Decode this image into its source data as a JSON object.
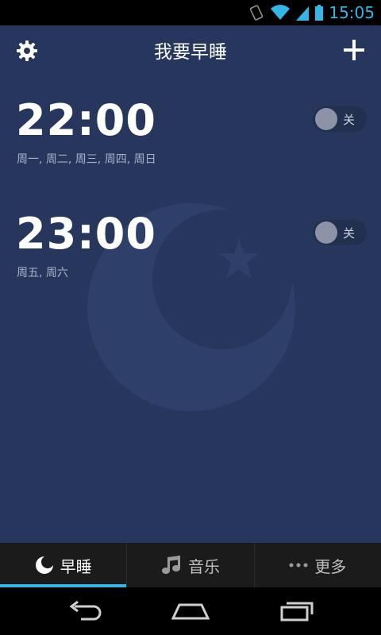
{
  "status_bar": {
    "time": "15:05",
    "icons": [
      "vibrate-icon",
      "wifi-icon",
      "signal-icon",
      "battery-icon"
    ],
    "accent": "#33b5e5"
  },
  "header": {
    "title": "我要早睡",
    "left_icon": "gear-icon",
    "right_icon": "plus-icon"
  },
  "alarms": [
    {
      "time": "22:00",
      "days": "周一, 周二, 周三, 周四, 周日",
      "toggle_label": "关",
      "enabled": false
    },
    {
      "time": "23:00",
      "days": "周五, 周六",
      "toggle_label": "关",
      "enabled": false
    }
  ],
  "tabs": [
    {
      "label": "早睡",
      "icon": "moon-icon",
      "active": true
    },
    {
      "label": "音乐",
      "icon": "music-note-icon",
      "active": false
    },
    {
      "label": "更多",
      "icon": "more-dots-icon",
      "active": false
    }
  ],
  "nav_bar": {
    "buttons": [
      "back-icon",
      "home-icon",
      "recent-apps-icon"
    ]
  },
  "colors": {
    "background": "#27365d",
    "tab_bar": "#1b1b1b",
    "tab_indicator": "#33b5e5",
    "days_text": "#a9b3cc"
  }
}
